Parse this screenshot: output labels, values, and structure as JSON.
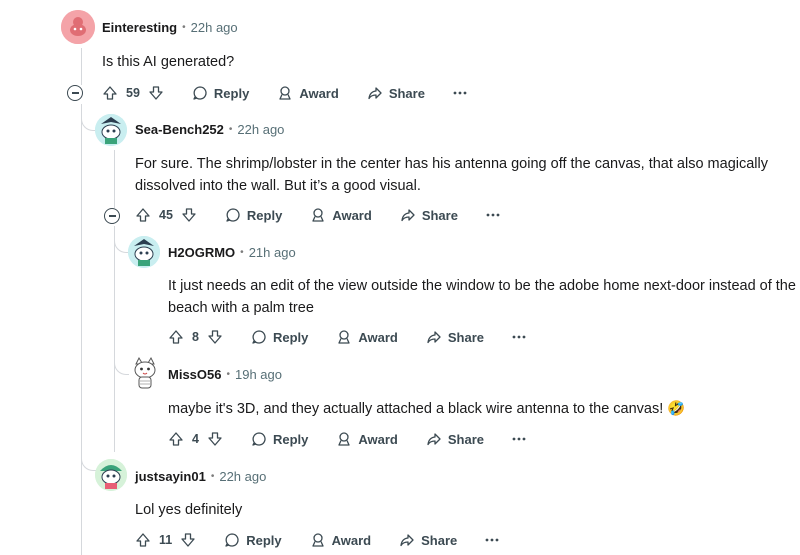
{
  "comments": [
    {
      "username": "Einteresting",
      "time": "22h ago",
      "body": [
        "Is this AI generated?"
      ],
      "votes": "59",
      "actions": {
        "reply": "Reply",
        "award": "Award",
        "share": "Share"
      }
    },
    {
      "username": "Sea-Bench252",
      "time": "22h ago",
      "body": [
        "For sure. The shrimp/lobster in the center has his antenna going off the canvas, that also magically",
        "dissolved into the wall. But it’s a good visual."
      ],
      "votes": "45",
      "actions": {
        "reply": "Reply",
        "award": "Award",
        "share": "Share"
      }
    },
    {
      "username": "H2OGRMO",
      "time": "21h ago",
      "body": [
        "It just needs an edit of the view outside the window to be the adobe home next-door instead of the",
        "beach with a palm tree"
      ],
      "votes": "8",
      "actions": {
        "reply": "Reply",
        "award": "Award",
        "share": "Share"
      }
    },
    {
      "username": "MissO56",
      "time": "19h ago",
      "body": [
        "maybe it's 3D, and they actually attached a black wire antenna to the canvas!"
      ],
      "emoji": "🤣",
      "votes": "4",
      "actions": {
        "reply": "Reply",
        "award": "Award",
        "share": "Share"
      }
    },
    {
      "username": "justsayin01",
      "time": "22h ago",
      "body": [
        "Lol yes definitely"
      ],
      "votes": "11",
      "actions": {
        "reply": "Reply",
        "award": "Award",
        "share": "Share"
      }
    }
  ],
  "colors": {
    "avatar_1": "#f4a3a8",
    "avatar_2": "#c9eef0",
    "avatar_5": "#d6f2d9",
    "thread_line": "#d5d8dc",
    "meta_text": "#576f76"
  },
  "icons": {
    "upvote": "arrow-up-icon",
    "downvote": "arrow-down-icon",
    "reply": "speech-bubble-icon",
    "award": "award-icon",
    "share": "share-arrow-icon",
    "more": "ellipsis-icon",
    "collapse": "minus-circle-icon"
  }
}
